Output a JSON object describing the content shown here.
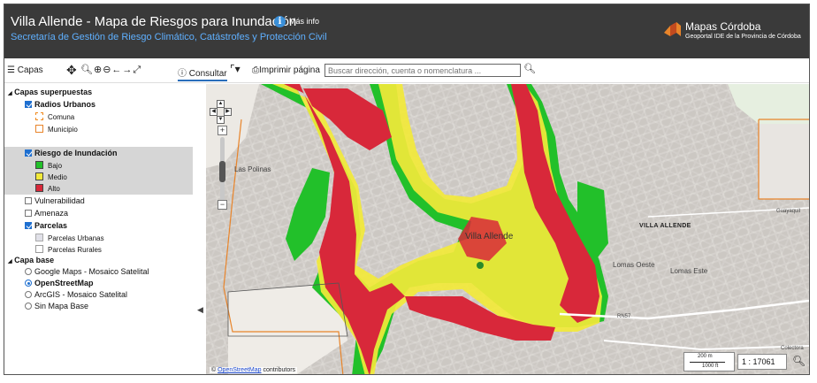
{
  "header": {
    "title": "Villa Allende - Mapa de Riesgos para Inundación",
    "info_label": "Más info",
    "subtitle": "Secretaría de Gestión de Riesgo Climático, Catástrofes y Protección Civil",
    "brand_name": "Mapas Córdoba",
    "brand_sub": "Geoportal IDE de la Provincia de Córdoba"
  },
  "toolbar": {
    "capas_label": "Capas",
    "consultar_label": "Consultar",
    "imprimir_label": "Imprimir página",
    "search_placeholder": "Buscar dirección, cuenta o nomenclatura ..."
  },
  "sidebar": {
    "overlay_header": "Capas superpuestas",
    "radios_label": "Radios Urbanos",
    "comuna_label": "Comuna",
    "municipio_label": "Municipio",
    "riesgo_label": "Riesgo de Inundación",
    "bajo_label": "Bajo",
    "medio_label": "Medio",
    "alto_label": "Alto",
    "vulnerabilidad_label": "Vulnerabilidad",
    "amenaza_label": "Amenaza",
    "parcelas_label": "Parcelas",
    "parcelas_urbanas_label": "Parcelas Urbanas",
    "parcelas_rurales_label": "Parcelas Rurales",
    "base_header": "Capa base",
    "google_label": "Google Maps - Mosaico Satelital",
    "osm_label": "OpenStreetMap",
    "arcgis_label": "ArcGIS - Mosaico Satelital",
    "sin_label": "Sin Mapa Base"
  },
  "colors": {
    "bajo": "#22c02a",
    "medio": "#f2e93a",
    "alto": "#d8283a",
    "comuna": "#f08a1e",
    "municipio": "#e8842a"
  },
  "map": {
    "label_villa": "Villa Allende",
    "label_villa_caps": "VILLA ALLENDE",
    "label_las_polinas": "Las Polinas",
    "label_lomas_oeste": "Lomas Oeste",
    "label_lomas_este": "Lomas Este",
    "label_guayaquil": "Guayaquil",
    "label_colectora": "Colectora",
    "label_rn57": "RN57",
    "osm_link": "OpenStreetMap",
    "osm_suffix": "contributors",
    "scale_m": "200 m",
    "scale_ft": "1000 ft",
    "scale_ratio": "1 : 17061"
  }
}
